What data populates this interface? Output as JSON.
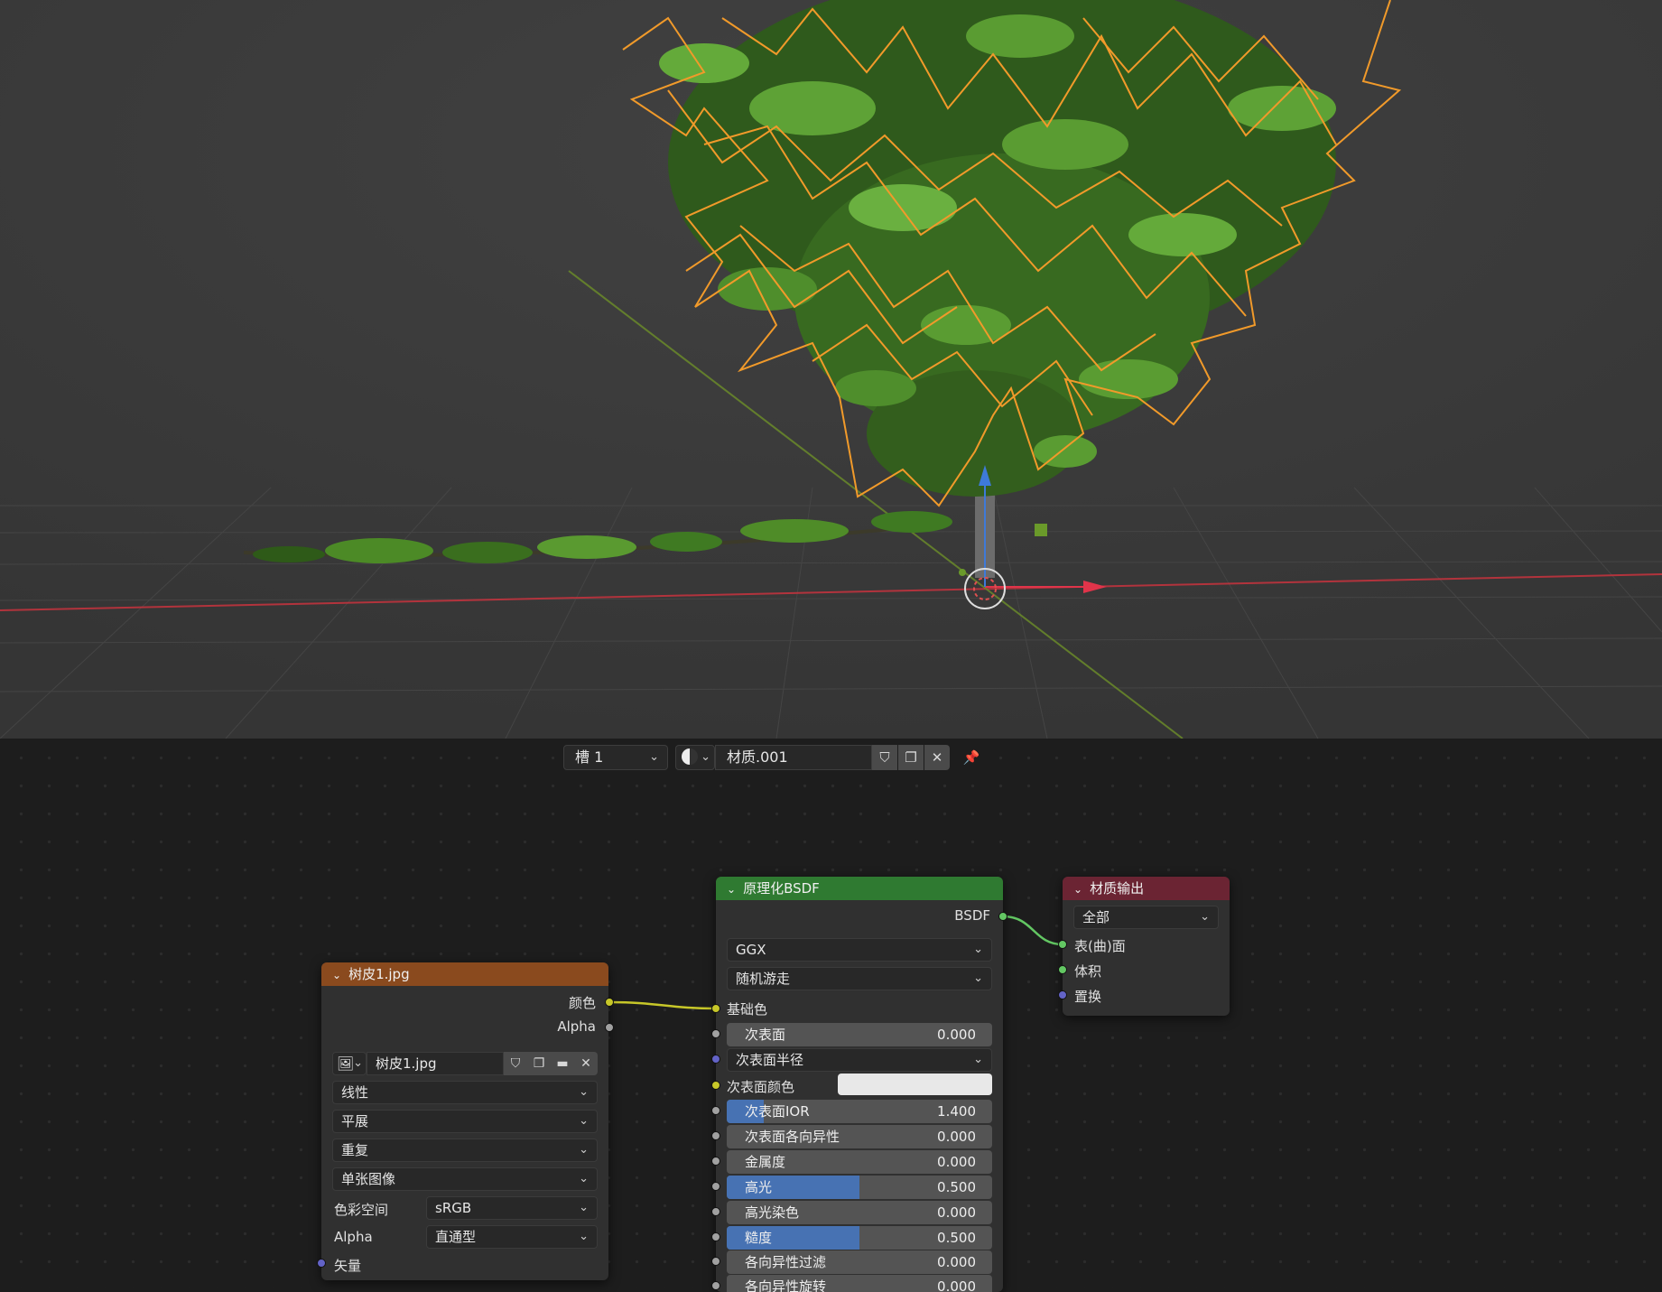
{
  "viewport": {
    "label": "3D viewport with selected tree object"
  },
  "header": {
    "slot": "槽 1",
    "material_name": "材质.001"
  },
  "image_node": {
    "title": "树皮1.jpg",
    "outputs": [
      "颜色",
      "Alpha"
    ],
    "image_name": "树皮1.jpg",
    "interpolation": "线性",
    "projection": "平展",
    "extension": "重复",
    "source": "单张图像",
    "colorspace_label": "色彩空间",
    "colorspace_value": "sRGB",
    "alpha_label": "Alpha",
    "alpha_value": "直通型",
    "vector_input": "矢量",
    "header_color": "#8a4a1e"
  },
  "bsdf_node": {
    "title": "原理化BSDF",
    "output": "BSDF",
    "distribution": "GGX",
    "subsurface_method": "随机游走",
    "base_color": "基础色",
    "subsurface": {
      "label": "次表面",
      "value": "0.000",
      "fill": 0
    },
    "subsurface_radius": "次表面半径",
    "subsurface_color": "次表面颜色",
    "subsurface_ior": {
      "label": "次表面IOR",
      "value": "1.400",
      "fill": 0.14
    },
    "subsurface_anisotropy": {
      "label": "次表面各向异性",
      "value": "0.000",
      "fill": 0
    },
    "metallic": {
      "label": "金属度",
      "value": "0.000",
      "fill": 0
    },
    "specular": {
      "label": "高光",
      "value": "0.500",
      "fill": 0.5
    },
    "specular_tint": {
      "label": "高光染色",
      "value": "0.000",
      "fill": 0
    },
    "roughness": {
      "label": "糙度",
      "value": "0.500",
      "fill": 0.5
    },
    "anisotropic": {
      "label": "各向异性过滤",
      "value": "0.000",
      "fill": 0
    },
    "anisotropic_rotation": {
      "label": "各向异性旋转",
      "value": "0.000",
      "fill": 0
    },
    "header_color": "#2f7a31"
  },
  "output_node": {
    "title": "材质输出",
    "target": "全部",
    "inputs": [
      "表(曲)面",
      "体积",
      "置换"
    ],
    "header_color": "#6b2433"
  },
  "colors": {
    "selection_outline": "#f19a2a",
    "x_axis": "#c8333e",
    "y_axis": "#6a8a2a",
    "z_gizmo": "#3e7ad8"
  }
}
